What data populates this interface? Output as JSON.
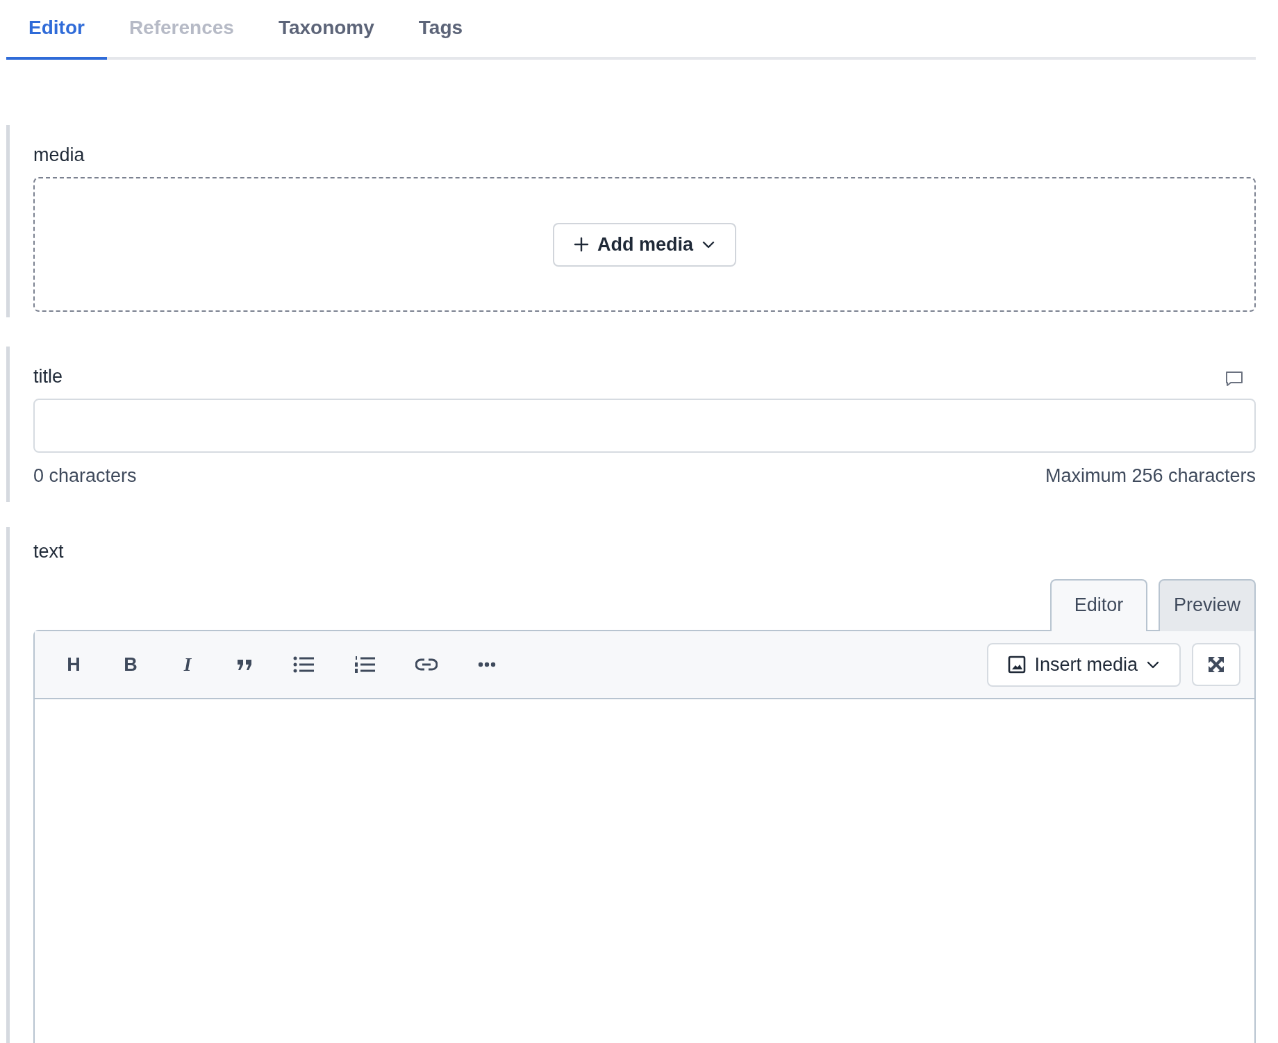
{
  "tabs": [
    {
      "label": "Editor",
      "selected": true,
      "disabled": false
    },
    {
      "label": "References",
      "selected": false,
      "disabled": true
    },
    {
      "label": "Taxonomy",
      "selected": false,
      "disabled": false
    },
    {
      "label": "Tags",
      "selected": false,
      "disabled": false
    }
  ],
  "media": {
    "label": "media",
    "add_button": "Add media"
  },
  "title": {
    "label": "title",
    "count": "0 characters",
    "maximum": "Maximum 256 characters"
  },
  "text": {
    "label": "text",
    "modes": [
      {
        "label": "Editor",
        "selected": true
      },
      {
        "label": "Preview",
        "selected": false
      }
    ],
    "toolbar": [
      {
        "kind": "heading",
        "glyph": "H"
      },
      {
        "kind": "bold",
        "glyph": "B"
      },
      {
        "kind": "italic",
        "glyph": "I"
      },
      {
        "kind": "quote"
      },
      {
        "kind": "bullet-list"
      },
      {
        "kind": "numbered-list"
      },
      {
        "kind": "link"
      },
      {
        "kind": "more"
      }
    ],
    "insert_button": "Insert media"
  }
}
